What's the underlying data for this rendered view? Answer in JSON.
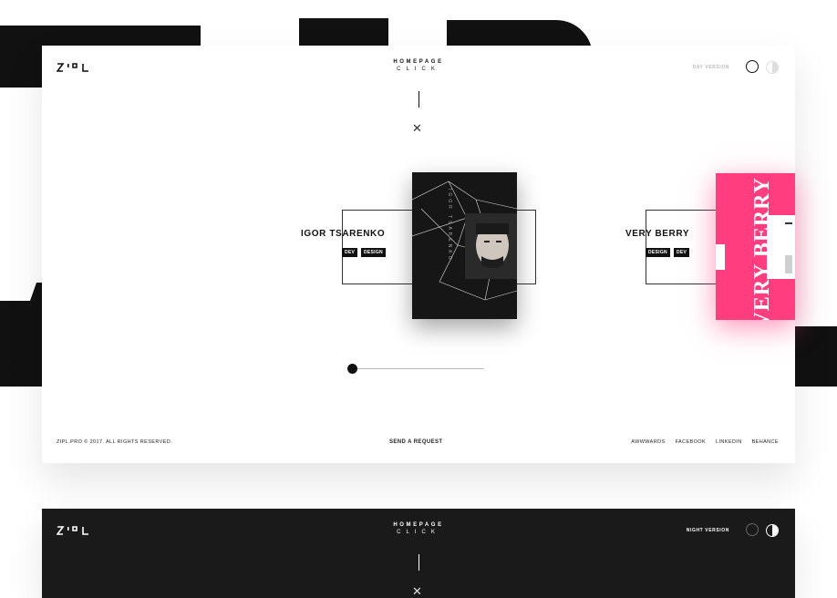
{
  "brand": {
    "logo_text": "ZIPL"
  },
  "light_screen": {
    "nav": {
      "title": "HOMEPAGE",
      "subtitle": "CLICK"
    },
    "version_label": "DAY VERSION",
    "slides": [
      {
        "title": "IGOR TSARENKO",
        "tags": [
          "DEV",
          "DESIGN"
        ],
        "card_text": "IGOR TSARENKO"
      },
      {
        "title": "VERY BERRY",
        "tags": [
          "DESIGN",
          "DEV"
        ],
        "card_text": "VERY BERRY"
      }
    ],
    "slider_value": 0,
    "footer": {
      "copyright": "ZIPL.PRO © 2017. ALL RIGHTS RESERVED.",
      "cta": "SEND A REQUEST",
      "links": [
        "AWWWARDS",
        "FACEBOOK",
        "LINKEDIN",
        "BEHANCE"
      ]
    }
  },
  "dark_screen": {
    "nav": {
      "title": "HOMEPAGE",
      "subtitle": "CLICK"
    },
    "version_label": "NIGHT VERSION"
  },
  "colors": {
    "ink": "#111111",
    "pink": "#ff3d7f",
    "dark_bg": "#1a1a1a"
  }
}
